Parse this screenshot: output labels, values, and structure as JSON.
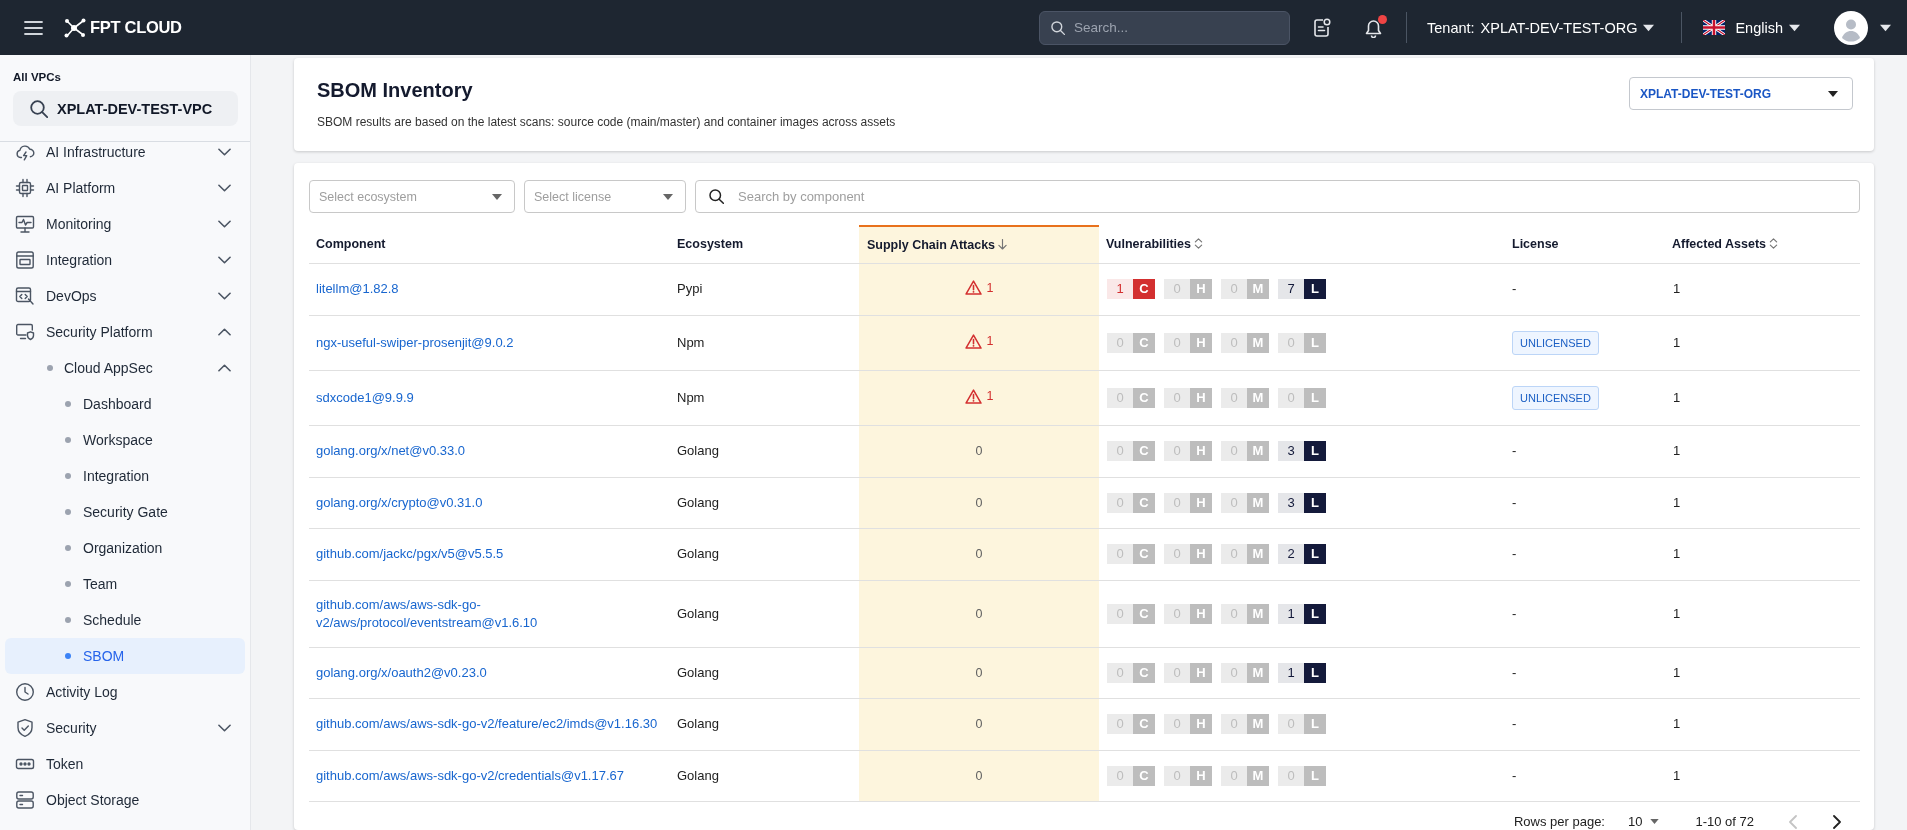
{
  "topbar": {
    "brand": "FPT CLOUD",
    "search": {
      "placeholder": "Search..."
    },
    "notifications": {
      "unread": true
    },
    "tenant": {
      "label": "Tenant:",
      "value": "XPLAT-DEV-TEST-ORG"
    },
    "language": "English"
  },
  "sidebar": {
    "vpc_label": "All VPCs",
    "vpc_search": {
      "value": "XPLAT-DEV-TEST-VPC"
    },
    "items": [
      {
        "label": "AI Infrastructure",
        "expanded": false,
        "selected": false
      },
      {
        "label": "AI Platform",
        "expanded": false,
        "selected": false
      },
      {
        "label": "Monitoring",
        "expanded": false,
        "selected": false
      },
      {
        "label": "Integration",
        "expanded": false,
        "selected": false
      },
      {
        "label": "DevOps",
        "expanded": false,
        "selected": false
      },
      {
        "label": "Security Platform",
        "expanded": true,
        "selected": false,
        "children": [
          {
            "label": "Cloud AppSec",
            "expanded": true,
            "selected": false,
            "children": [
              {
                "label": "Dashboard",
                "selected": false
              },
              {
                "label": "Workspace",
                "selected": false
              },
              {
                "label": "Integration",
                "selected": false
              },
              {
                "label": "Security Gate",
                "selected": false
              },
              {
                "label": "Organization",
                "selected": false
              },
              {
                "label": "Team",
                "selected": false
              },
              {
                "label": "Schedule",
                "selected": false
              },
              {
                "label": "SBOM",
                "selected": true
              }
            ]
          }
        ]
      },
      {
        "label": "Activity Log",
        "selected": false
      },
      {
        "label": "Security",
        "expanded": false,
        "selected": false
      },
      {
        "label": "Token",
        "selected": false
      },
      {
        "label": "Object Storage",
        "selected": false
      }
    ]
  },
  "page_header": {
    "title": "SBOM Inventory",
    "subtitle": "SBOM results are based on the latest scans: source code (main/master) and container images across assets",
    "org_select": {
      "value": "XPLAT-DEV-TEST-ORG"
    }
  },
  "filters": {
    "ecosystem": {
      "placeholder": "Select ecosystem"
    },
    "license": {
      "placeholder": "Select license"
    },
    "search": {
      "placeholder": "Search by component"
    }
  },
  "table": {
    "columns": [
      {
        "label": "Component",
        "sortable": false,
        "sorted": false
      },
      {
        "label": "Ecosystem",
        "sortable": false,
        "sorted": false
      },
      {
        "label": "Supply Chain Attacks",
        "sortable": true,
        "sorted": true
      },
      {
        "label": "Vulnerabilities",
        "sortable": true,
        "sorted": false
      },
      {
        "label": "License",
        "sortable": false,
        "sorted": false
      },
      {
        "label": "Affected Assets",
        "sortable": true,
        "sorted": false
      }
    ],
    "rows": [
      {
        "component": "litellm@1.82.8",
        "ecosystem": "Pypi",
        "supply_chain_attacks": {
          "count": "1",
          "flagged": true
        },
        "vulnerabilities": [
          {
            "letter": "C",
            "count": "1",
            "active": true,
            "color": "#d32f2f"
          },
          {
            "letter": "H",
            "count": "0",
            "active": false
          },
          {
            "letter": "M",
            "count": "0",
            "active": false
          },
          {
            "letter": "L",
            "count": "7",
            "active": true,
            "color": "#141a3b"
          }
        ],
        "license": {
          "text": "-",
          "kind": "plain"
        },
        "affected_assets": "1"
      },
      {
        "component": "ngx-useful-swiper-prosenjit@9.0.2",
        "ecosystem": "Npm",
        "supply_chain_attacks": {
          "count": "1",
          "flagged": true
        },
        "vulnerabilities": [
          {
            "letter": "C",
            "count": "0",
            "active": false
          },
          {
            "letter": "H",
            "count": "0",
            "active": false
          },
          {
            "letter": "M",
            "count": "0",
            "active": false
          },
          {
            "letter": "L",
            "count": "0",
            "active": false
          }
        ],
        "license": {
          "text": "UNLICENSED",
          "kind": "badge"
        },
        "affected_assets": "1"
      },
      {
        "component": "sdxcode1@9.9.9",
        "ecosystem": "Npm",
        "supply_chain_attacks": {
          "count": "1",
          "flagged": true
        },
        "vulnerabilities": [
          {
            "letter": "C",
            "count": "0",
            "active": false
          },
          {
            "letter": "H",
            "count": "0",
            "active": false
          },
          {
            "letter": "M",
            "count": "0",
            "active": false
          },
          {
            "letter": "L",
            "count": "0",
            "active": false
          }
        ],
        "license": {
          "text": "UNLICENSED",
          "kind": "badge"
        },
        "affected_assets": "1"
      },
      {
        "component": "golang.org/x/net@v0.33.0",
        "ecosystem": "Golang",
        "supply_chain_attacks": {
          "count": "0",
          "flagged": false
        },
        "vulnerabilities": [
          {
            "letter": "C",
            "count": "0",
            "active": false
          },
          {
            "letter": "H",
            "count": "0",
            "active": false
          },
          {
            "letter": "M",
            "count": "0",
            "active": false
          },
          {
            "letter": "L",
            "count": "3",
            "active": true,
            "color": "#141a3b"
          }
        ],
        "license": {
          "text": "-",
          "kind": "plain"
        },
        "affected_assets": "1"
      },
      {
        "component": "golang.org/x/crypto@v0.31.0",
        "ecosystem": "Golang",
        "supply_chain_attacks": {
          "count": "0",
          "flagged": false
        },
        "vulnerabilities": [
          {
            "letter": "C",
            "count": "0",
            "active": false
          },
          {
            "letter": "H",
            "count": "0",
            "active": false
          },
          {
            "letter": "M",
            "count": "0",
            "active": false
          },
          {
            "letter": "L",
            "count": "3",
            "active": true,
            "color": "#141a3b"
          }
        ],
        "license": {
          "text": "-",
          "kind": "plain"
        },
        "affected_assets": "1"
      },
      {
        "component": "github.com/jackc/pgx/v5@v5.5.5",
        "ecosystem": "Golang",
        "supply_chain_attacks": {
          "count": "0",
          "flagged": false
        },
        "vulnerabilities": [
          {
            "letter": "C",
            "count": "0",
            "active": false
          },
          {
            "letter": "H",
            "count": "0",
            "active": false
          },
          {
            "letter": "M",
            "count": "0",
            "active": false
          },
          {
            "letter": "L",
            "count": "2",
            "active": true,
            "color": "#141a3b"
          }
        ],
        "license": {
          "text": "-",
          "kind": "plain"
        },
        "affected_assets": "1"
      },
      {
        "component": "github.com/aws/aws-sdk-go-v2/aws/protocol/eventstream@v1.6.10",
        "ecosystem": "Golang",
        "supply_chain_attacks": {
          "count": "0",
          "flagged": false
        },
        "vulnerabilities": [
          {
            "letter": "C",
            "count": "0",
            "active": false
          },
          {
            "letter": "H",
            "count": "0",
            "active": false
          },
          {
            "letter": "M",
            "count": "0",
            "active": false
          },
          {
            "letter": "L",
            "count": "1",
            "active": true,
            "color": "#141a3b"
          }
        ],
        "license": {
          "text": "-",
          "kind": "plain"
        },
        "affected_assets": "1"
      },
      {
        "component": "golang.org/x/oauth2@v0.23.0",
        "ecosystem": "Golang",
        "supply_chain_attacks": {
          "count": "0",
          "flagged": false
        },
        "vulnerabilities": [
          {
            "letter": "C",
            "count": "0",
            "active": false
          },
          {
            "letter": "H",
            "count": "0",
            "active": false
          },
          {
            "letter": "M",
            "count": "0",
            "active": false
          },
          {
            "letter": "L",
            "count": "1",
            "active": true,
            "color": "#141a3b"
          }
        ],
        "license": {
          "text": "-",
          "kind": "plain"
        },
        "affected_assets": "1"
      },
      {
        "component": "github.com/aws/aws-sdk-go-v2/feature/ec2/imds@v1.16.30",
        "ecosystem": "Golang",
        "supply_chain_attacks": {
          "count": "0",
          "flagged": false
        },
        "vulnerabilities": [
          {
            "letter": "C",
            "count": "0",
            "active": false
          },
          {
            "letter": "H",
            "count": "0",
            "active": false
          },
          {
            "letter": "M",
            "count": "0",
            "active": false
          },
          {
            "letter": "L",
            "count": "0",
            "active": false
          }
        ],
        "license": {
          "text": "-",
          "kind": "plain"
        },
        "affected_assets": "1"
      },
      {
        "component": "github.com/aws/aws-sdk-go-v2/credentials@v1.17.67",
        "ecosystem": "Golang",
        "supply_chain_attacks": {
          "count": "0",
          "flagged": false
        },
        "vulnerabilities": [
          {
            "letter": "C",
            "count": "0",
            "active": false
          },
          {
            "letter": "H",
            "count": "0",
            "active": false
          },
          {
            "letter": "M",
            "count": "0",
            "active": false
          },
          {
            "letter": "L",
            "count": "0",
            "active": false
          }
        ],
        "license": {
          "text": "-",
          "kind": "plain"
        },
        "affected_assets": "1"
      }
    ]
  },
  "pagination": {
    "rows_per_page_label": "Rows per page:",
    "rows_per_page": "10",
    "range": "1-10 of 72",
    "prev": {
      "disabled": true
    },
    "next": {
      "disabled": false
    }
  }
}
